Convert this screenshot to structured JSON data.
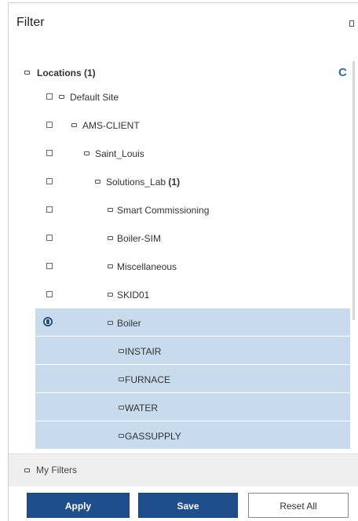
{
  "header": {
    "title": "Filter"
  },
  "locations": {
    "label": "Locations",
    "count": "(1)",
    "refresh_glyph": "C"
  },
  "tree": [
    {
      "label": "Default Site",
      "count": ""
    },
    {
      "label": "AMS-CLIENT",
      "count": ""
    },
    {
      "label": "Saint_Louis",
      "count": ""
    },
    {
      "label": "Solutions_Lab",
      "count": "(1)"
    },
    {
      "label": "Smart Commissioning",
      "count": ""
    },
    {
      "label": "Boiler-SIM",
      "count": ""
    },
    {
      "label": "Miscellaneous",
      "count": ""
    },
    {
      "label": "SKID01",
      "count": ""
    },
    {
      "label": "Boiler",
      "count": ""
    },
    {
      "label": "INSTAIR",
      "count": ""
    },
    {
      "label": "FURNACE",
      "count": ""
    },
    {
      "label": "WATER",
      "count": ""
    },
    {
      "label": "GASSUPPLY",
      "count": ""
    }
  ],
  "my_filters": {
    "label": "My Filters"
  },
  "buttons": {
    "apply": "Apply",
    "save": "Save",
    "reset": "Reset All"
  },
  "colors": {
    "primary": "#1f4e8c",
    "selected_row": "#c7dbec",
    "refresh": "#2b6cb0"
  }
}
